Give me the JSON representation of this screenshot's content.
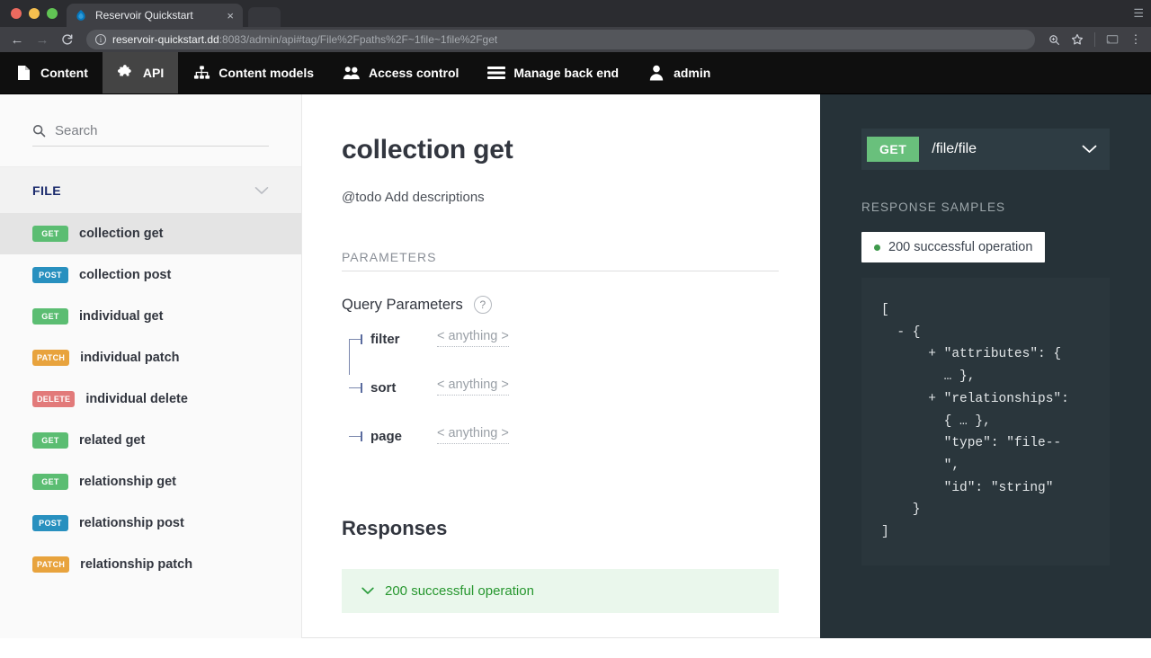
{
  "browser": {
    "tab_title": "Reservoir Quickstart",
    "tab_close": "×",
    "favicon": "drupal-droplet-icon",
    "url_host": "reservoir-quickstart.dd",
    "url_rest": ":8083/admin/api#tag/File%2Fpaths%2F~1file~1file%2Fget",
    "back_icon": "←",
    "forward_icon": "→",
    "reload_icon": "⟳",
    "zoom_icon": "search-plus-icon",
    "bookmark_icon": "star-icon",
    "cast_icon": "cast-icon",
    "menu_icon": "⋮"
  },
  "admin_bar": {
    "items": [
      {
        "label": "Content",
        "icon": "page-icon",
        "active": false
      },
      {
        "label": "API",
        "icon": "puzzle-icon",
        "active": true
      },
      {
        "label": "Content models",
        "icon": "sitemap-icon",
        "active": false
      },
      {
        "label": "Access control",
        "icon": "people-icon",
        "active": false
      },
      {
        "label": "Manage back end",
        "icon": "hamburger-icon",
        "active": false
      },
      {
        "label": "admin",
        "icon": "user-icon",
        "active": false
      }
    ]
  },
  "sidebar": {
    "search_placeholder": "Search",
    "search_value": "",
    "group_label": "FILE",
    "operations": [
      {
        "method": "GET",
        "label": "collection get",
        "active": true
      },
      {
        "method": "POST",
        "label": "collection post",
        "active": false
      },
      {
        "method": "GET",
        "label": "individual get",
        "active": false
      },
      {
        "method": "PATCH",
        "label": "individual patch",
        "active": false
      },
      {
        "method": "DELETE",
        "label": "individual delete",
        "active": false
      },
      {
        "method": "GET",
        "label": "related get",
        "active": false
      },
      {
        "method": "GET",
        "label": "relationship get",
        "active": false
      },
      {
        "method": "POST",
        "label": "relationship post",
        "active": false
      },
      {
        "method": "PATCH",
        "label": "relationship patch",
        "active": false
      }
    ]
  },
  "main": {
    "title": "collection get",
    "description": "@todo Add descriptions",
    "parameters_heading": "PARAMETERS",
    "query_parameters_label": "Query Parameters",
    "help_icon_label": "?",
    "query_parameters": [
      {
        "name": "filter",
        "value": "< anything >"
      },
      {
        "name": "sort",
        "value": "< anything >"
      },
      {
        "name": "page",
        "value": "< anything >"
      }
    ],
    "responses_heading": "Responses",
    "responses": [
      {
        "label": "200 successful operation",
        "expanded": false
      }
    ]
  },
  "rightpanel": {
    "endpoint_method": "GET",
    "endpoint_path": "/file/file",
    "response_samples_heading": "RESPONSE SAMPLES",
    "sample_tab_label": "200 successful operation",
    "code_sample": "[\n  - {\n      + \"attributes\": {\n        … },\n      + \"relationships\":\n        { … },\n        \"type\": \"file--\n        \",\n        \"id\": \"string\"\n    }\n]"
  },
  "colors": {
    "get": "#5bbd72",
    "post": "#2890bf",
    "patch": "#e8a33d",
    "delete": "#e27a7a",
    "panel_bg": "#263238",
    "code_bg": "#2a363c",
    "response_bg": "#eaf7ec",
    "response_text": "#27972f",
    "group_label": "#1a2a6c"
  }
}
